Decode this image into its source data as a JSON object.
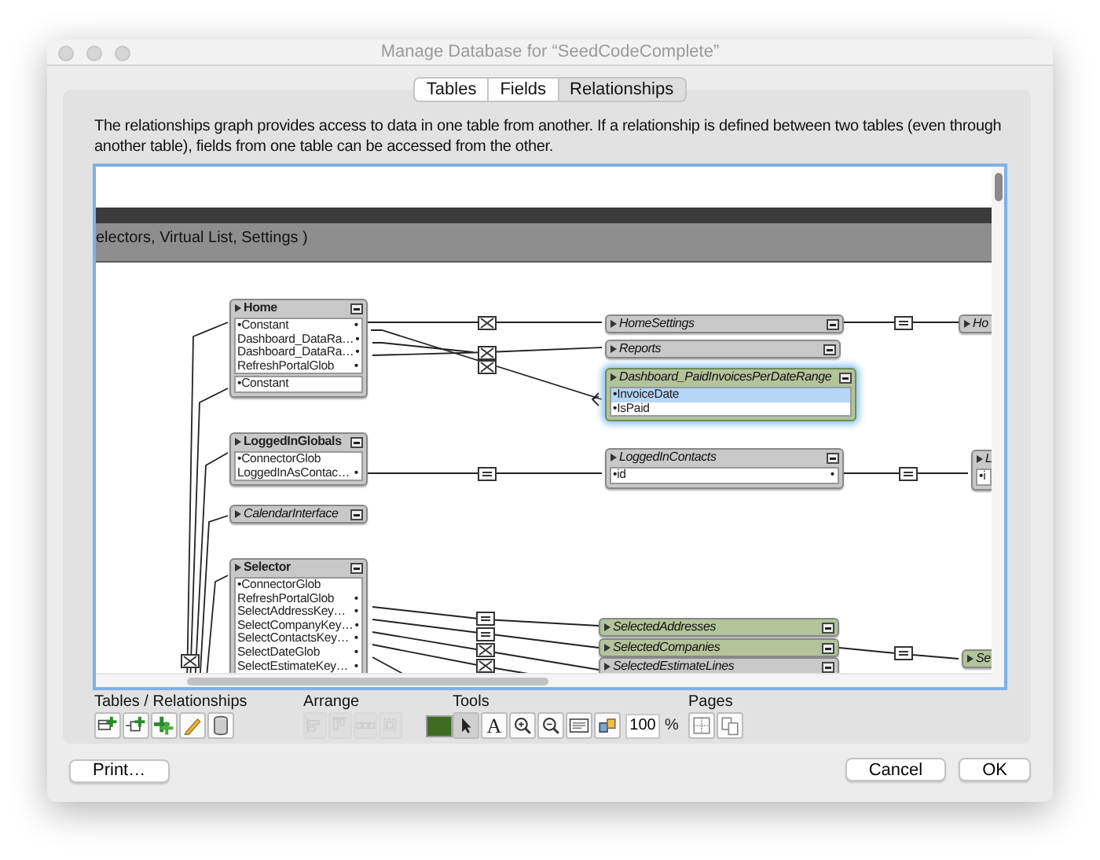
{
  "window": {
    "title": "Manage Database for “SeedCodeComplete”"
  },
  "tabs": [
    {
      "label": "Tables",
      "selected": false
    },
    {
      "label": "Fields",
      "selected": false
    },
    {
      "label": "Relationships",
      "selected": true
    }
  ],
  "description": "The relationships graph provides access to data in one table from another. If a relationship is defined between two tables (even through another table), fields from one table can be accessed from the other.",
  "graph": {
    "band_text": "electors, Virtual List, Settings )",
    "tables": [
      {
        "name": "Home",
        "color": "#c8c8c8",
        "external": false,
        "collapsed": false,
        "selected": false,
        "fields": [
          {
            "name": "•Constant",
            "right_mark": "•",
            "selected": false
          },
          {
            "name": "Dashboard_DataRa…",
            "right_mark": "•",
            "selected": false
          },
          {
            "name": "Dashboard_DataRa…",
            "right_mark": "•",
            "selected": false
          },
          {
            "name": "RefreshPortalGlob",
            "right_mark": "•",
            "selected": false
          }
        ],
        "lower_fields": [
          {
            "name": "•Constant",
            "selected": false
          }
        ]
      },
      {
        "name": "LoggedInGlobals",
        "color": "#c8c8c8",
        "external": false,
        "collapsed": false,
        "selected": false,
        "fields": [
          {
            "name": "•ConnectorGlob",
            "selected": false
          },
          {
            "name": "LoggedInAsContac…",
            "right_mark": "•",
            "selected": false
          }
        ]
      },
      {
        "name": "CalendarInterface",
        "color": "#c8c8c8",
        "external": true,
        "collapsed": true,
        "selected": false
      },
      {
        "name": "Selector",
        "color": "#c8c8c8",
        "external": false,
        "collapsed": false,
        "selected": false,
        "fields": [
          {
            "name": "•ConnectorGlob",
            "selected": false
          },
          {
            "name": "RefreshPortalGlob",
            "right_mark": "•",
            "selected": false
          },
          {
            "name": "SelectAddressKey…",
            "right_mark": "•",
            "selected": false
          },
          {
            "name": "SelectCompanyKey…",
            "right_mark": "•",
            "selected": false
          },
          {
            "name": "SelectContactsKey…",
            "right_mark": "•",
            "selected": false
          },
          {
            "name": "SelectDateGlob",
            "right_mark": "•",
            "selected": false
          },
          {
            "name": "SelectEstimateKey…",
            "right_mark": "•",
            "selected": false
          }
        ]
      },
      {
        "name": "HomeSettings",
        "color": "#c8c8c8",
        "external": true,
        "collapsed": true,
        "selected": false
      },
      {
        "name": "Reports",
        "color": "#c8c8c8",
        "external": true,
        "collapsed": true,
        "selected": false
      },
      {
        "name": "Dashboard_PaidInvoicesPerDateRange",
        "color": "#b3c39a",
        "external": true,
        "collapsed": false,
        "selected": true,
        "fields": [
          {
            "name": "•InvoiceDate",
            "selected": true
          },
          {
            "name": "•IsPaid",
            "selected": false
          }
        ]
      },
      {
        "name": "LoggedInContacts",
        "color": "#c8c8c8",
        "external": true,
        "collapsed": false,
        "selected": false,
        "fields": [
          {
            "name": "•id",
            "right_mark": "•",
            "selected": false
          }
        ]
      },
      {
        "name": "Ho",
        "color": "#c8c8c8",
        "external": true,
        "collapsed": true,
        "selected": false
      },
      {
        "name": "L",
        "color": "#c8c8c8",
        "external": true,
        "collapsed": false,
        "selected": false,
        "fields": [
          {
            "name": "•i",
            "selected": false
          }
        ]
      },
      {
        "name": "SelectedAddresses",
        "color": "#b3c39a",
        "external": true,
        "collapsed": true,
        "selected": false
      },
      {
        "name": "SelectedCompanies",
        "color": "#b3c39a",
        "external": true,
        "collapsed": true,
        "selected": false
      },
      {
        "name": "SelectedEstimateLines",
        "color": "#c8c8c8",
        "external": true,
        "collapsed": true,
        "selected": false
      },
      {
        "name": "Se",
        "color": "#b3c39a",
        "external": true,
        "collapsed": true,
        "selected": false
      }
    ]
  },
  "toolbar": [
    {
      "label": "Tables / Relationships",
      "items": [
        {
          "kind": "add-table",
          "disabled": false
        },
        {
          "kind": "add-relationship",
          "disabled": false
        },
        {
          "kind": "duplicate",
          "disabled": false
        },
        {
          "kind": "edit",
          "disabled": false
        },
        {
          "kind": "delete",
          "disabled": false
        }
      ]
    },
    {
      "label": "Arrange",
      "items": [
        {
          "kind": "align-left",
          "disabled": true
        },
        {
          "kind": "align-top",
          "disabled": true
        },
        {
          "kind": "distribute",
          "disabled": true
        },
        {
          "kind": "resize",
          "disabled": true
        },
        {
          "kind": "color",
          "color": "#3d6b22"
        }
      ]
    },
    {
      "label": "Tools",
      "items": [
        {
          "kind": "pointer",
          "selected": true
        },
        {
          "kind": "text",
          "selected": false,
          "label": "A"
        },
        {
          "kind": "zoom-in",
          "selected": false
        },
        {
          "kind": "zoom-out",
          "selected": false
        },
        {
          "kind": "toggle-size",
          "selected": false
        },
        {
          "kind": "highlight",
          "selected": false
        }
      ],
      "zoom": {
        "value": "100",
        "unit": "%"
      }
    },
    {
      "label": "Pages",
      "items": [
        {
          "kind": "page-grid",
          "disabled": false
        },
        {
          "kind": "page-setup",
          "disabled": false
        }
      ]
    }
  ],
  "footer": {
    "left": [
      {
        "label": "Print…"
      }
    ],
    "right": [
      {
        "label": "Cancel"
      },
      {
        "label": "OK"
      }
    ]
  }
}
